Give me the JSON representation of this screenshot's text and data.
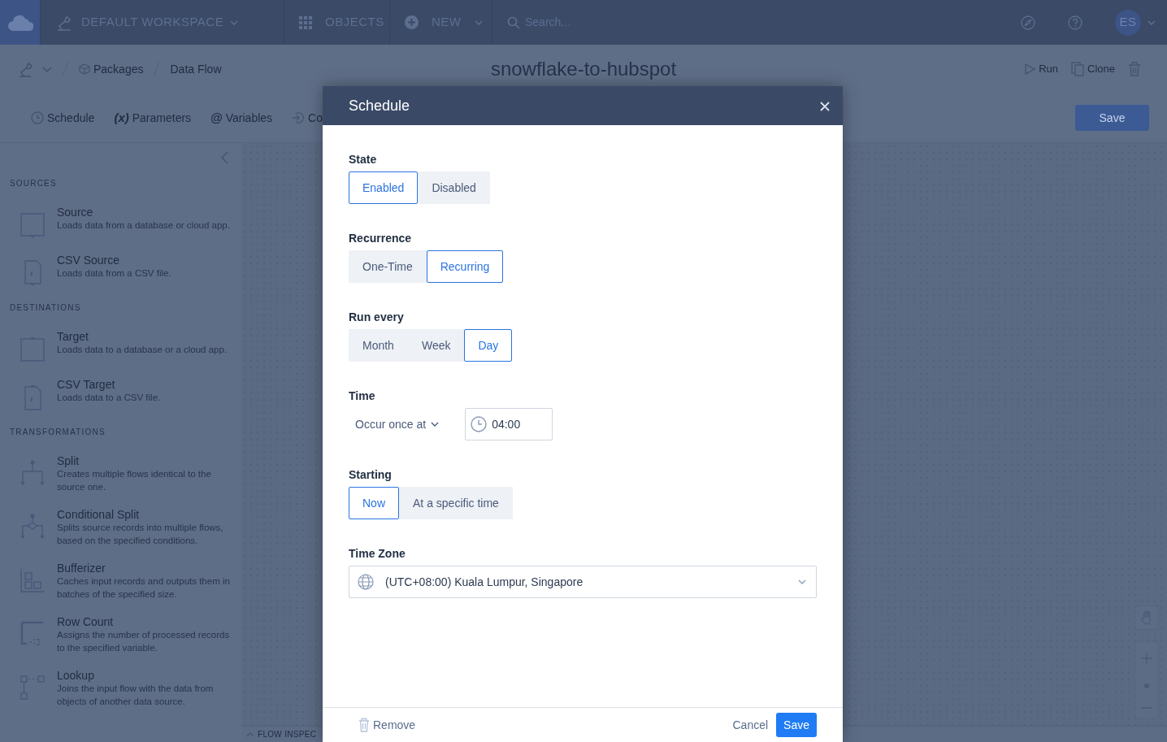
{
  "navbar": {
    "workspace": "DEFAULT WORKSPACE",
    "objects": "OBJECTS",
    "new": "NEW",
    "search": {
      "placeholder": "Search..."
    },
    "avatar": "ES"
  },
  "header": {
    "breadcrumbs": [
      "Packages",
      "Data Flow"
    ],
    "title": "snowflake-to-hubspot",
    "actions": [
      "Run",
      "Clone"
    ]
  },
  "toolbar": {
    "tabs": [
      {
        "label": "Schedule"
      },
      {
        "glyph": "(x)",
        "label": "Parameters"
      },
      {
        "glyph": "@",
        "label": "Variables"
      },
      {
        "label": "Co"
      }
    ],
    "save": "Save"
  },
  "sidebar": {
    "sections": [
      {
        "heading": "SOURCES",
        "items": [
          {
            "name": "Source",
            "description": "Loads data from a database or cloud app."
          },
          {
            "name": "CSV Source",
            "description": "Loads data from a CSV file."
          }
        ]
      },
      {
        "heading": "DESTINATIONS",
        "items": [
          {
            "name": "Target",
            "description": "Loads data to a database or a cloud app."
          },
          {
            "name": "CSV Target",
            "description": "Loads data to a CSV file."
          }
        ]
      },
      {
        "heading": "TRANSFORMATIONS",
        "items": [
          {
            "name": "Split",
            "description": "Creates multiple flows identical to the source one."
          },
          {
            "name": "Conditional Split",
            "description": "Splits source records into multiple flows, based on the specified conditions."
          },
          {
            "name": "Bufferizer",
            "description": "Caches input records and outputs them in batches of the specified size."
          },
          {
            "name": "Row Count",
            "description": "Assigns the number of processed records to the specified variable."
          },
          {
            "name": "Lookup",
            "description": "Joins the input flow with the data from objects of another data source."
          }
        ]
      }
    ]
  },
  "canvas": {
    "inspector": "FLOW INSPEC"
  },
  "modal": {
    "title": "Schedule",
    "fields": [
      {
        "label": "State",
        "kind": "toggle",
        "options": [
          {
            "label": "Enabled",
            "selected": true
          },
          {
            "label": "Disabled",
            "selected": false
          }
        ]
      },
      {
        "label": "Recurrence",
        "kind": "toggle",
        "options": [
          {
            "label": "One-Time",
            "selected": false
          },
          {
            "label": "Recurring",
            "selected": true
          }
        ]
      },
      {
        "label": "Run every",
        "kind": "toggle",
        "options": [
          {
            "label": "Month",
            "selected": false
          },
          {
            "label": "Week",
            "selected": false
          },
          {
            "label": "Day",
            "selected": true
          }
        ]
      },
      {
        "label": "Time",
        "kind": "time",
        "mode": "Occur once at",
        "value": "04:00"
      },
      {
        "label": "Starting",
        "kind": "toggle",
        "options": [
          {
            "label": "Now",
            "selected": true
          },
          {
            "label": "At a specific time",
            "selected": false
          }
        ]
      },
      {
        "label": "Time Zone",
        "kind": "select",
        "value": "(UTC+08:00) Kuala Lumpur, Singapore"
      }
    ],
    "footer": {
      "remove": "Remove",
      "cancel": "Cancel",
      "save": "Save"
    }
  }
}
